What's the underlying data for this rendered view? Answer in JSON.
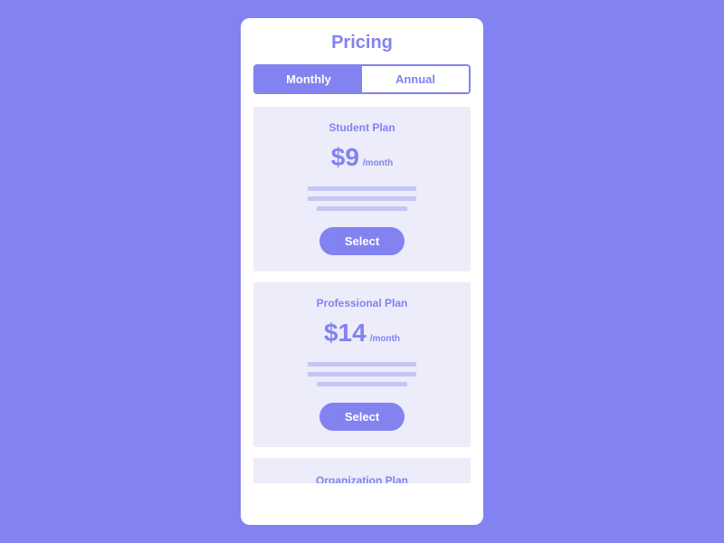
{
  "page": {
    "title": "Pricing"
  },
  "toggle": {
    "monthly": "Monthly",
    "annual": "Annual",
    "active": "monthly"
  },
  "plans": [
    {
      "name": "Student Plan",
      "price": "$9",
      "period": "/month",
      "cta": "Select"
    },
    {
      "name": "Professional Plan",
      "price": "$14",
      "period": "/month",
      "cta": "Select"
    },
    {
      "name": "Organization Plan"
    }
  ]
}
